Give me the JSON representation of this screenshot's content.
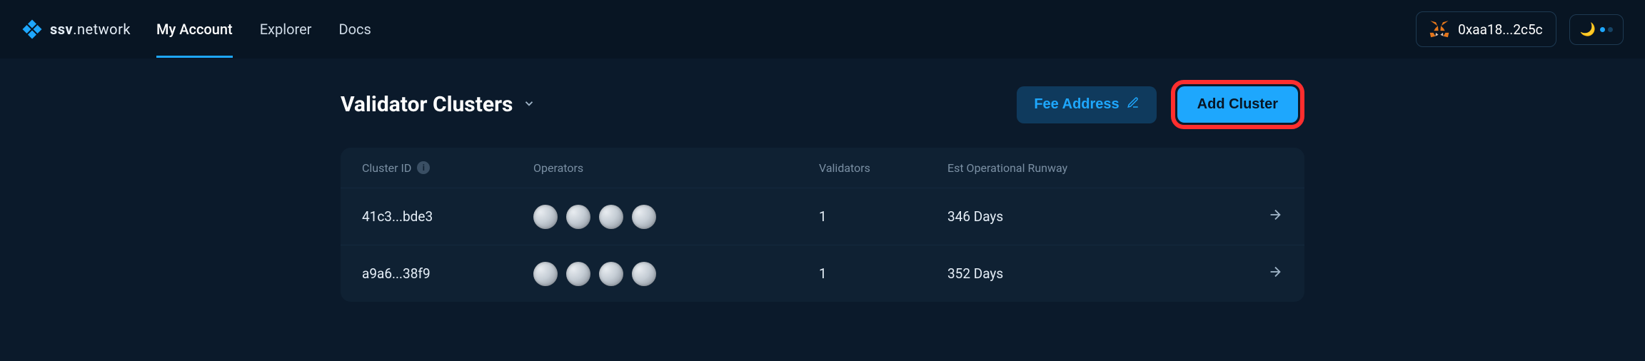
{
  "brand": {
    "name_bold": "ssv",
    "name_rest": ".network"
  },
  "nav": {
    "my_account": "My Account",
    "explorer": "Explorer",
    "docs": "Docs"
  },
  "wallet": {
    "address": "0xaa18...2c5c"
  },
  "page": {
    "title": "Validator Clusters",
    "fee_address": "Fee Address",
    "add_cluster": "Add Cluster"
  },
  "table": {
    "headers": {
      "cluster_id": "Cluster ID",
      "operators": "Operators",
      "validators": "Validators",
      "runway": "Est Operational Runway"
    },
    "rows": [
      {
        "cluster_id": "41c3...bde3",
        "validators": "1",
        "runway": "346 Days"
      },
      {
        "cluster_id": "a9a6...38f9",
        "validators": "1",
        "runway": "352 Days"
      }
    ]
  }
}
